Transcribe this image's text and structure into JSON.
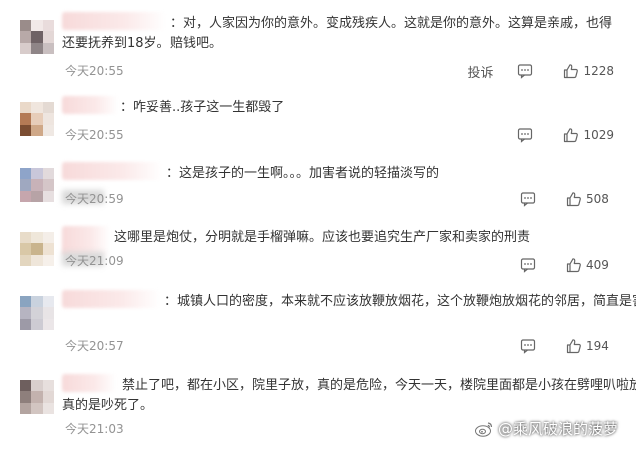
{
  "comments": [
    {
      "text_lead": "：对，人家因为你的意外。变成残疾人。这就是你的意外。这算是亲戚，也得赔钱吧。",
      "text_cont": "还要抚养到18岁。",
      "time": "今天20:55",
      "report": "投诉",
      "likes": "1228",
      "avatar_colors": [
        "#9a8c8a",
        "#f2e9e8",
        "#e9dcdc",
        "#b8a9a8",
        "#6f6265",
        "#e3d7d6",
        "#d8cccb",
        "#8f8587",
        "#c9bfc0"
      ]
    },
    {
      "text_lead": "：咋妥善..孩子这一生都毁了",
      "time": "今天20:55",
      "likes": "1029",
      "avatar_colors": [
        "#ead9c9",
        "#f0e6de",
        "#e4dad3",
        "#b47a55",
        "#e7cdb9",
        "#eee5df",
        "#7b4d32",
        "#cfa888",
        "#efe8e3"
      ]
    },
    {
      "text_lead": "：这是孩子的一生啊。。。加害者说的轻描淡写的",
      "time": "今天20:59",
      "likes": "508",
      "avatar_colors": [
        "#8ea4c9",
        "#c9c7da",
        "#e2dadc",
        "#9fa8c0",
        "#c8b2b8",
        "#d5c6c8",
        "#c6a6ad",
        "#b7a3a6",
        "#e7dfe0"
      ]
    },
    {
      "text_lead": "这哪里是炮仗，分明就是手榴弹嘛。应该也要追究生产厂家和卖家的刑责",
      "time": "今天21:09",
      "likes": "409",
      "avatar_colors": [
        "#e8dcc9",
        "#efe7da",
        "#f4eee8",
        "#d9c8a7",
        "#c9b48d",
        "#eee2d3",
        "#e3d6bf",
        "#efe6da",
        "#f6f0ea"
      ]
    },
    {
      "text_lead": "：城镇人口的密度，本来就不应该放鞭放烟花，这个放鞭炮放烟花的邻居，简直是害人",
      "time": "今天20:57",
      "likes": "194",
      "avatar_colors": [
        "#8aa4c0",
        "#c9d2de",
        "#e7e9ef",
        "#b6b4c1",
        "#d3d2d8",
        "#e8e4e6",
        "#9d9aa7",
        "#cdcbd3",
        "#ebe6e8"
      ]
    },
    {
      "text_lead": "禁止了吧，都在小区，院里子放，真的是危险，今天一天，楼院里面都是小孩在劈哩叭啦放，",
      "text_cont": "真的是吵死了。",
      "time": "今天21:03",
      "avatar_colors": [
        "#6e5f5e",
        "#d9cfcd",
        "#e7dfdd",
        "#8e7f7c",
        "#c3b2ae",
        "#e2d8d5",
        "#b3a4a0",
        "#d2c5c1",
        "#eae3e1"
      ]
    }
  ],
  "icons": {
    "reply": "comment-bubble-icon",
    "like": "thumbs-up-icon",
    "watermark": "weibo-logo-icon"
  },
  "watermark": "@乘风破浪的菠萝",
  "colors": {
    "text": "#333333",
    "time": "#939393",
    "name_blur": "#f7dada"
  }
}
